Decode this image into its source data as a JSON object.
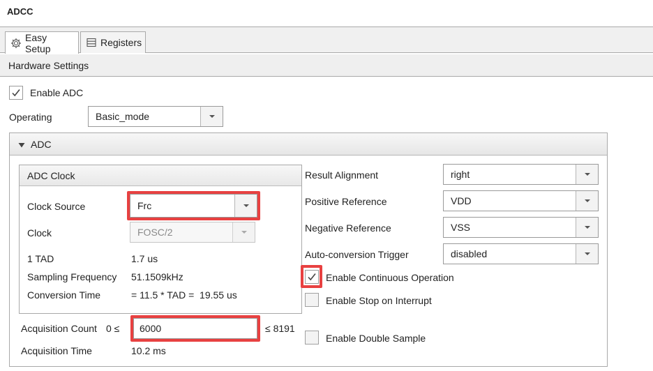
{
  "title": "ADCC",
  "tabs": [
    {
      "label": "Easy Setup",
      "icon": "gear-icon",
      "active": true
    },
    {
      "label": "Registers",
      "icon": "registers-icon",
      "active": false
    }
  ],
  "hardware_settings_label": "Hardware Settings",
  "enable_adc": {
    "label": "Enable ADC",
    "checked": true
  },
  "operating": {
    "label": "Operating",
    "value": "Basic_mode"
  },
  "adc_panel": {
    "label": "ADC",
    "expanded": true
  },
  "adc_clock": {
    "title": "ADC Clock",
    "clock_source": {
      "label": "Clock Source",
      "value": "Frc"
    },
    "clock": {
      "label": "Clock",
      "value": "FOSC/2",
      "disabled": true
    },
    "tad": {
      "label": "1 TAD",
      "value": "1.7 us"
    },
    "sampling_frequency": {
      "label": "Sampling Frequency",
      "value": "51.1509kHz"
    },
    "conversion_time": {
      "label": "Conversion Time",
      "value": "= 11.5 * TAD =  19.55 us"
    }
  },
  "acquisition_count": {
    "label": "Acquisition Count",
    "min_text": "0 ≤",
    "value": "6000",
    "max_text": "≤ 8191"
  },
  "acquisition_time": {
    "label": "Acquisition Time",
    "value": "10.2 ms"
  },
  "right_settings": {
    "result_alignment": {
      "label": "Result Alignment",
      "value": "right"
    },
    "positive_reference": {
      "label": "Positive Reference",
      "value": "VDD"
    },
    "negative_reference": {
      "label": "Negative Reference",
      "value": "VSS"
    },
    "auto_conversion_trigger": {
      "label": "Auto-conversion Trigger",
      "value": "disabled"
    }
  },
  "options": {
    "continuous_operation": {
      "label": "Enable Continuous Operation",
      "checked": true
    },
    "stop_on_interrupt": {
      "label": "Enable Stop on Interrupt",
      "checked": false
    },
    "double_sample": {
      "label": "Enable Double Sample",
      "checked": false
    }
  },
  "colors": {
    "highlight": "#e84141",
    "panel_border": "#a9a9a9",
    "header_bg": "#efefef"
  }
}
